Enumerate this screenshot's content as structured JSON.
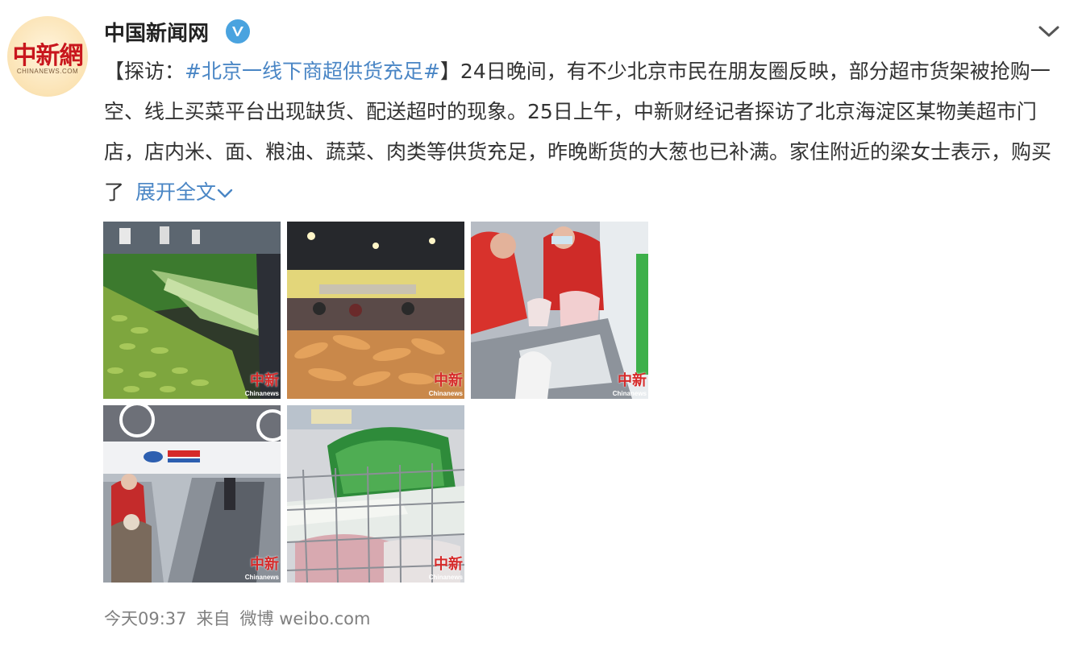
{
  "author": {
    "name": "中国新闻网",
    "avatar_logo_text": "中新網",
    "avatar_logo_subtext": "CHINANEWS.COM",
    "verified_icon": "verified-v-icon"
  },
  "post": {
    "prefix": "【探访：",
    "hashtag": "#北京一线下商超供货充足#",
    "body": "】24日晚间，有不少北京市民在朋友圈反映，部分超市货架被抢购一空、线上买菜平台出现缺货、配送超时的现象。25日上午，中新财经记者探访了北京海淀区某物美超市门店，店内米、面、粮油、蔬菜、肉类等供货充足，昨晚断货的大葱也已补满。家住附近的梁女士表示，购买了",
    "expand_label": "展开全文"
  },
  "images": [
    {
      "subject": "vegetable-shelves",
      "watermark_cn": "中新",
      "watermark_en": "Chinanews"
    },
    {
      "subject": "carrots-produce",
      "watermark_cn": "中新",
      "watermark_en": "Chinanews"
    },
    {
      "subject": "checkout-staff",
      "watermark_cn": "中新",
      "watermark_en": "Chinanews"
    },
    {
      "subject": "escalator-store-entrance",
      "watermark_cn": "中新",
      "watermark_en": "Chinanews"
    },
    {
      "subject": "shopping-cart",
      "watermark_cn": "中新",
      "watermark_en": "Chinanews"
    }
  ],
  "footer": {
    "time": "今天09:37",
    "from_label": "来自",
    "source": "微博 weibo.com"
  },
  "colors": {
    "link": "#4a86c5",
    "text": "#333333",
    "meta": "#808080",
    "verified": "#4aa3df"
  }
}
